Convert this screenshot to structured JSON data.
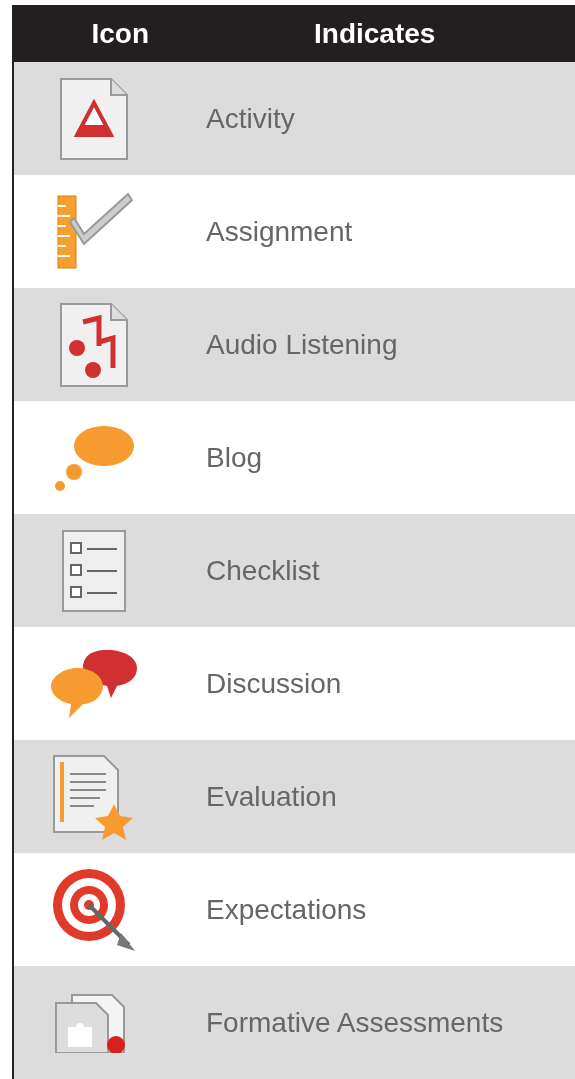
{
  "columns": [
    "Icon",
    "Indicates"
  ],
  "rows": [
    {
      "kind": "activity",
      "label": "Activity"
    },
    {
      "kind": "assignment",
      "label": "Assignment"
    },
    {
      "kind": "audio",
      "label": "Audio Listening"
    },
    {
      "kind": "blog",
      "label": "Blog"
    },
    {
      "kind": "checklist",
      "label": "Checklist"
    },
    {
      "kind": "discussion",
      "label": "Discussion"
    },
    {
      "kind": "evaluation",
      "label": "Evaluation"
    },
    {
      "kind": "expectations",
      "label": "Expectations"
    },
    {
      "kind": "formative",
      "label": "Formative Assessments"
    }
  ]
}
